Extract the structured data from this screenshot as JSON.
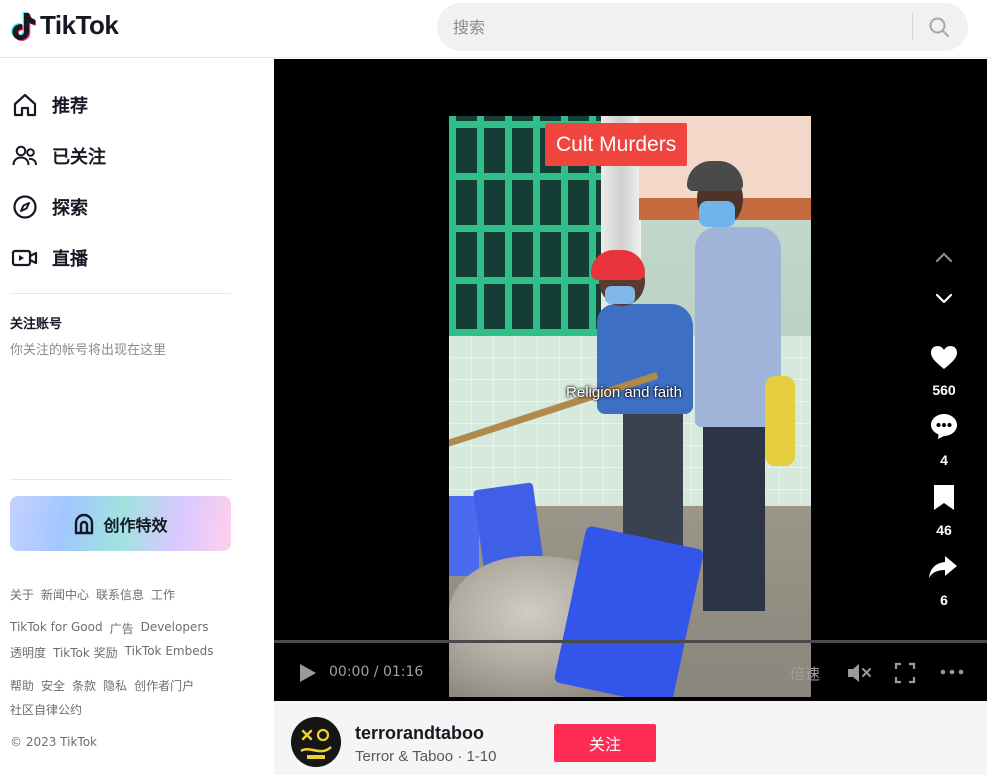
{
  "header": {
    "logo_text": "TikTok",
    "search_placeholder": "搜索"
  },
  "sidebar": {
    "nav": [
      {
        "label": "推荐",
        "icon": "home-icon"
      },
      {
        "label": "已关注",
        "icon": "following-icon"
      },
      {
        "label": "探索",
        "icon": "compass-icon"
      },
      {
        "label": "直播",
        "icon": "live-icon"
      }
    ],
    "following_title": "关注账号",
    "following_empty": "你关注的帐号将出现在这里",
    "create_effects_label": "创作特效",
    "footer": [
      [
        "关于",
        "新闻中心",
        "联系信息",
        "工作"
      ],
      [
        "TikTok for Good",
        "广告",
        "Developers"
      ],
      [
        "透明度",
        "TikTok 奖励",
        "TikTok Embeds"
      ],
      [
        "帮助",
        "安全",
        "条款",
        "隐私",
        "创作者门户"
      ],
      [
        "社区自律公约"
      ],
      [
        "© 2023 TikTok"
      ]
    ]
  },
  "video": {
    "badge": "Cult Murders",
    "caption": "Religion and faith",
    "time": "00:00 / 01:16",
    "speed_label": "倍速",
    "progress": 0
  },
  "actions": {
    "likes": "560",
    "comments": "4",
    "saves": "46",
    "shares": "6"
  },
  "author": {
    "username": "terrorandtaboo",
    "subtitle": "Terror & Taboo · 1-10",
    "follow_label": "关注"
  },
  "colors": {
    "accent": "#fe2c55",
    "badge": "#f0443f"
  }
}
